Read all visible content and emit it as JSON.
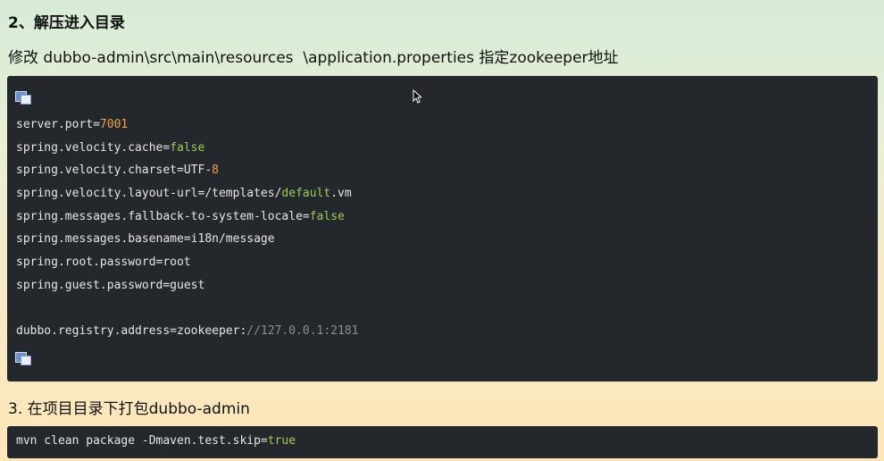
{
  "section2": {
    "heading": "2、解压进入目录",
    "description": "修改 dubbo-admin\\src\\main\\resources  \\application.properties 指定zookeeper地址"
  },
  "config_code": {
    "lines": [
      [
        {
          "t": "server.port=",
          "c": "pl"
        },
        {
          "t": "7001",
          "c": "num"
        }
      ],
      [
        {
          "t": "spring.velocity.cache=",
          "c": "pl"
        },
        {
          "t": "false",
          "c": "kw"
        }
      ],
      [
        {
          "t": "spring.velocity.charset=UTF-",
          "c": "pl"
        },
        {
          "t": "8",
          "c": "num"
        }
      ],
      [
        {
          "t": "spring.velocity.layout-url=/templates/",
          "c": "pl"
        },
        {
          "t": "default",
          "c": "kw"
        },
        {
          "t": ".vm",
          "c": "pl"
        }
      ],
      [
        {
          "t": "spring.messages.fallback-to-system-locale=",
          "c": "pl"
        },
        {
          "t": "false",
          "c": "kw"
        }
      ],
      [
        {
          "t": "spring.messages.basename=i18n/message",
          "c": "pl"
        }
      ],
      [
        {
          "t": "spring.root.password=root",
          "c": "pl"
        }
      ],
      [
        {
          "t": "spring.guest.password=guest",
          "c": "pl"
        }
      ],
      [
        {
          "t": "",
          "c": "pl"
        }
      ],
      [
        {
          "t": "dubbo.registry.address=zookeeper:",
          "c": "pl"
        },
        {
          "t": "//127.0.0.1:2181",
          "c": "cm"
        }
      ]
    ]
  },
  "section3": {
    "heading": "3. 在项目目录下打包dubbo-admin"
  },
  "build_command": [
    {
      "t": "mvn clean package -Dmaven.test.skip=",
      "c": "pl"
    },
    {
      "t": "true",
      "c": "kw"
    }
  ],
  "icons": {
    "copy": "copy-code-icon",
    "cursor": "mouse-pointer-icon"
  },
  "colors": {
    "code_bg": "#24272b",
    "number": "#f0a04b",
    "keyword": "#9acd5a",
    "comment": "#8a8f95"
  }
}
